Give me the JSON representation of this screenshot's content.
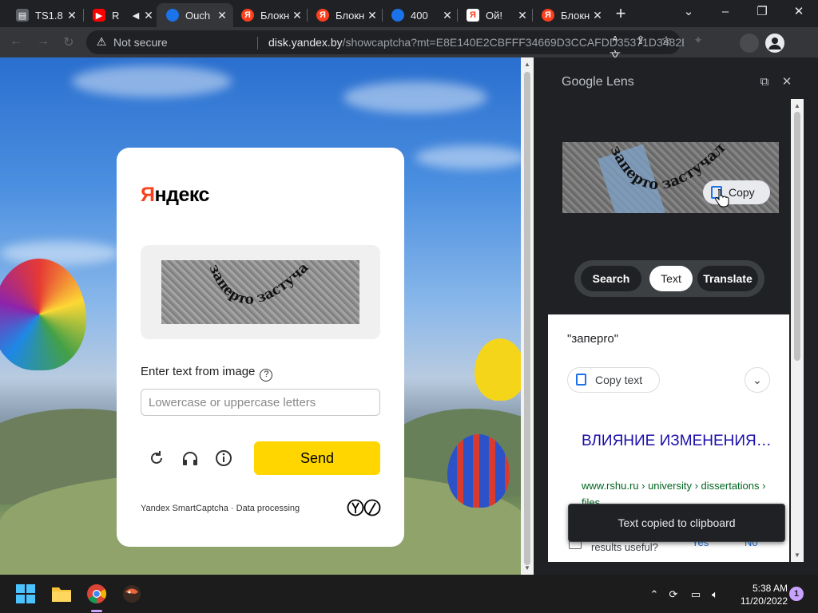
{
  "browser": {
    "tabs": [
      {
        "title": "TS1.8",
        "color": "#e8eaed"
      },
      {
        "title": "R",
        "color": "#ff0000"
      },
      {
        "title": "Ouch",
        "color": "#1a73e8",
        "active": true
      },
      {
        "title": "Блокн",
        "color": "#fc3f1d"
      },
      {
        "title": "Блокн",
        "color": "#fc3f1d"
      },
      {
        "title": "400",
        "color": "#1a73e8"
      },
      {
        "title": "Ой!",
        "color": "#ffffff"
      },
      {
        "title": "Блокн",
        "color": "#fc3f1d"
      }
    ],
    "security_label": "Not secure",
    "url_host": "disk.yandex.by",
    "url_path": "/showcaptcha?mt=E8E140E2CBFFF34669D3CCAFDD35371D3482BC0..."
  },
  "captcha": {
    "logo_first": "Я",
    "logo_rest": "ндекс",
    "captcha_text": "заперто застучал",
    "prompt": "Enter text from image",
    "help_glyph": "?",
    "input_placeholder": "Lowercase or uppercase letters",
    "input_value": "",
    "send_label": "Send",
    "footer_brand": "Yandex SmartCaptcha",
    "footer_sep": " · ",
    "footer_link": "Data processing"
  },
  "lens": {
    "title": "Google Lens",
    "image_text": "заперто застучал",
    "copy_chip_label": "Copy",
    "modes": [
      "Search",
      "Text",
      "Translate"
    ],
    "active_mode": "Text",
    "detected_text": "\"запеpro\"",
    "copy_text_label": "Copy text",
    "result_title": "ВЛИЯНИЕ ИЗМЕНЕНИЯ…",
    "result_breadcrumb": "www.rshu.ru › university › dissertations › files",
    "feedback_question": "results useful?",
    "feedback_yes": "Yes",
    "feedback_no": "No",
    "toast": "Text copied to clipboard"
  },
  "taskbar": {
    "time": "5:38 AM",
    "date": "11/20/2022",
    "notification_count": "1"
  },
  "colors": {
    "accent_yellow": "#ffd600",
    "yandex_red": "#fc3f1d",
    "link_blue": "#1a0dab",
    "url_green": "#006621"
  }
}
